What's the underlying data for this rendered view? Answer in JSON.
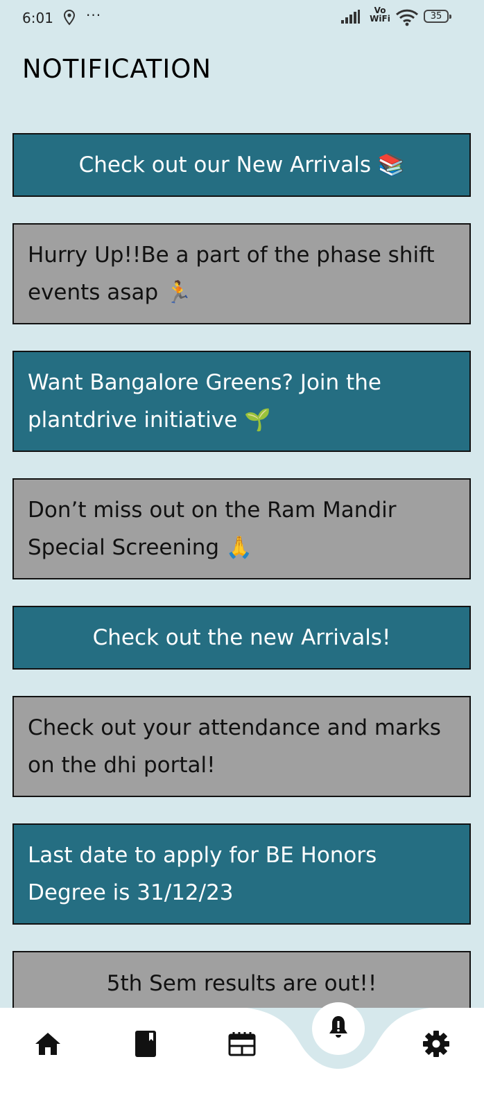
{
  "status_bar": {
    "time": "6:01",
    "dots": "···",
    "network": "Vo WiFi",
    "battery": "35"
  },
  "page_title": "NOTIFICATION",
  "notifications": [
    {
      "text": "Check out our New Arrivals 📚",
      "style": "teal"
    },
    {
      "text": "Hurry Up!!Be a part of the phase shift events asap 🏃",
      "style": "gray"
    },
    {
      "text": "Want Bangalore Greens? Join the plantdrive initiative 🌱",
      "style": "teal"
    },
    {
      "text": "Don’t miss out on the Ram Mandir Special Screening 🙏",
      "style": "gray"
    },
    {
      "text": "Check out the new Arrivals!",
      "style": "teal"
    },
    {
      "text": "Check out your attendance and marks on the dhi portal!",
      "style": "gray"
    },
    {
      "text": "Last date to apply for BE Honors Degree is 31/12/23",
      "style": "teal"
    },
    {
      "text": "5th Sem results are out!!",
      "style": "gray"
    }
  ],
  "bottom_nav": {
    "items": [
      "home-icon",
      "book-icon",
      "calendar-icon",
      "bell-icon",
      "gear-icon"
    ],
    "active": "bell-icon"
  },
  "colors": {
    "background": "#d6e8ec",
    "teal_card": "#256e82",
    "gray_card": "#a0a0a0"
  }
}
